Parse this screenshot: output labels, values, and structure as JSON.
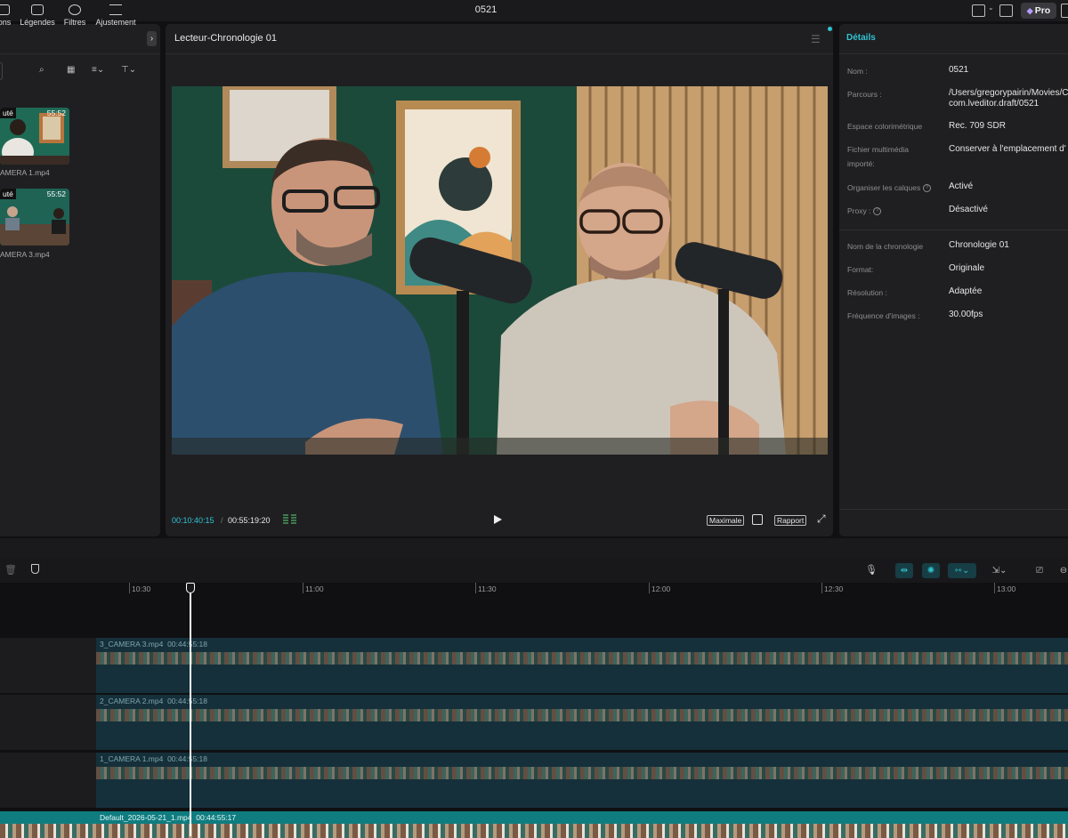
{
  "window": {
    "title": "0521"
  },
  "topbar": {
    "pro_label": "Pro"
  },
  "left_panel": {
    "tools": [
      "ions",
      "Légendes",
      "Filtres",
      "Ajustement"
    ],
    "clips": [
      {
        "badge": "uté",
        "duration": "55:52",
        "name": "AMERA 1.mp4"
      },
      {
        "badge": "uté",
        "duration": "55:52",
        "name": "AMERA 3.mp4"
      }
    ]
  },
  "viewer": {
    "title": "Lecteur-Chronologie 01",
    "current_time": "00:10:40:15",
    "separator": "/",
    "total_time": "00:55:19:20",
    "quality_label": "Maximale",
    "ratio_label": "Rapport"
  },
  "details": {
    "tab": "Détails",
    "rows": [
      {
        "label": "Nom :",
        "value": "0521",
        "help": false
      },
      {
        "label": "Parcours :",
        "value": "/Users/gregorypairin/Movies/C",
        "value2": "com.lveditor.draft/0521",
        "help": false
      },
      {
        "label": "Espace colorimétrique",
        "value": "Rec. 709 SDR",
        "help": false
      },
      {
        "label": "Fichier multimédia importé:",
        "value": "Conserver à l'emplacement d'",
        "help": false
      },
      {
        "label": "Organiser les calques",
        "value": "Activé",
        "help": true
      },
      {
        "label": "Proxy :",
        "value": "Désactivé",
        "help": true
      },
      {
        "label": "Nom de la chronologie",
        "value": "Chronologie 01",
        "help": false
      },
      {
        "label": "Format:",
        "value": "Originale",
        "help": false
      },
      {
        "label": "Résolution :",
        "value": "Adaptée",
        "help": false
      },
      {
        "label": "Fréquence d'images :",
        "value": "30.00fps",
        "help": false
      }
    ]
  },
  "timeline": {
    "ruler": [
      "10:30",
      "11:00",
      "11:30",
      "12:00",
      "12:30",
      "13:00"
    ],
    "tracks": [
      {
        "clip_name": "3_CAMERA 3.mp4",
        "clip_duration": "00:44:55:18"
      },
      {
        "clip_name": "2_CAMERA 2.mp4",
        "clip_duration": "00:44:55:18"
      },
      {
        "clip_name": "1_CAMERA 1.mp4",
        "clip_duration": "00:44:55:18"
      }
    ],
    "main_clip": {
      "name": "Default_2026-05-21_1.mp4",
      "duration": "00:44:55:17"
    }
  },
  "colors": {
    "accent": "#31c3d1",
    "panel": "#1f1f21",
    "track": "#15303a",
    "main_track": "#0f7d80"
  },
  "icons": [
    "layout-icon",
    "subtitle-icon",
    "search-icon",
    "grid-view-icon",
    "sort-icon",
    "filter-icon",
    "play-icon",
    "crop-icon",
    "fullscreen-icon",
    "trash-icon",
    "marker-icon",
    "microphone-icon",
    "link-icon",
    "magnet-icon",
    "snap-icon",
    "select-icon",
    "preview-icon",
    "zoom-out-icon"
  ]
}
